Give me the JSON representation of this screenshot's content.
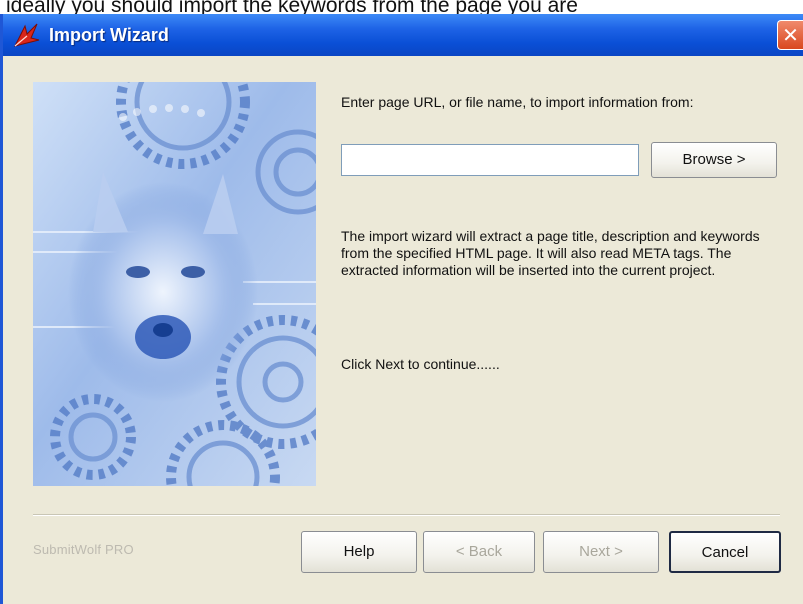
{
  "caption_above": "ideally you should import the keywords from the page you are",
  "window": {
    "title": "Import Wizard",
    "close_glyph": "✕",
    "title_bar_color": "#0a4fd6",
    "app_icon": "red-leaf-icon",
    "close_icon": "close-icon"
  },
  "wizard_image": {
    "subject": "wolf-and-gears-illustration"
  },
  "content": {
    "prompt": "Enter page URL, or file name, to import information from:",
    "url_input": {
      "value": "",
      "placeholder": ""
    },
    "browse_label": "Browse >",
    "description": "The import wizard will extract a page title, description and keywords from the specified HTML page. It will also read META tags. The extracted information will be inserted into the current project.",
    "next_hint": "Click Next to continue......"
  },
  "footer": {
    "brand": "SubmitWolf PRO",
    "help_label": "Help",
    "back_label": "< Back",
    "next_label": "Next >",
    "cancel_label": "Cancel"
  }
}
